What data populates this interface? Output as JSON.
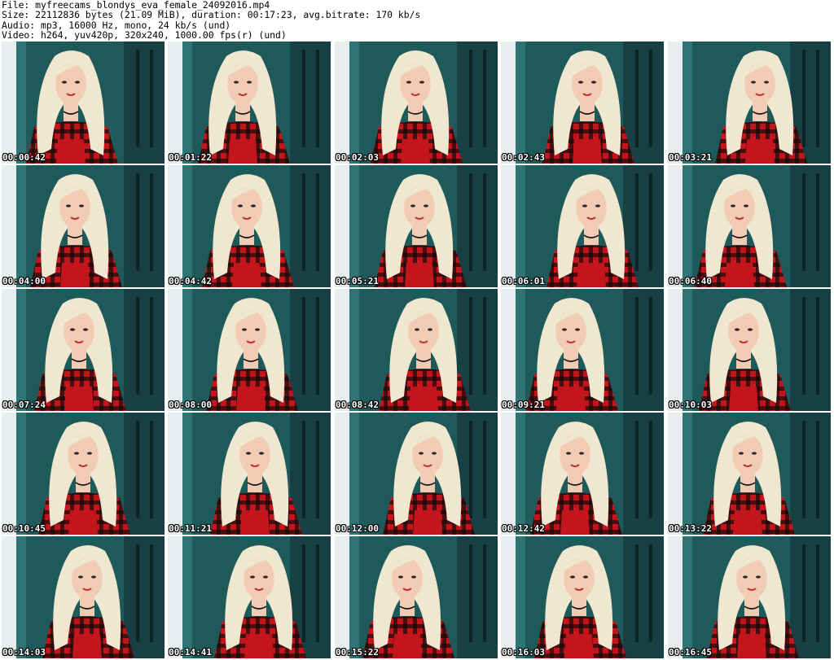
{
  "header": {
    "file": "File: myfreecams_blondys_eva_female_24092016.mp4",
    "size": "Size: 22112836 bytes (21.09 MiB), duration: 00:17:23, avg.bitrate: 170 kb/s",
    "audio": "Audio: mp3, 16000 Hz, mono, 24 kb/s (und)",
    "video": "Video: h264, yuv420p, 320x240, 1000.00 fps(r) (und)"
  },
  "thumbnails": [
    {
      "timestamp": "00:00:42"
    },
    {
      "timestamp": "00:01:22"
    },
    {
      "timestamp": "00:02:03"
    },
    {
      "timestamp": "00:02:43"
    },
    {
      "timestamp": "00:03:21"
    },
    {
      "timestamp": "00:04:00"
    },
    {
      "timestamp": "00:04:42"
    },
    {
      "timestamp": "00:05:21"
    },
    {
      "timestamp": "00:06:01"
    },
    {
      "timestamp": "00:06:40"
    },
    {
      "timestamp": "00:07:24"
    },
    {
      "timestamp": "00:08:00"
    },
    {
      "timestamp": "00:08:42"
    },
    {
      "timestamp": "00:09:21"
    },
    {
      "timestamp": "00:10:03"
    },
    {
      "timestamp": "00:10:45"
    },
    {
      "timestamp": "00:11:21"
    },
    {
      "timestamp": "00:12:00"
    },
    {
      "timestamp": "00:12:42"
    },
    {
      "timestamp": "00:13:22"
    },
    {
      "timestamp": "00:14:03"
    },
    {
      "timestamp": "00:14:41"
    },
    {
      "timestamp": "00:15:22"
    },
    {
      "timestamp": "00:16:03"
    },
    {
      "timestamp": "00:16:45"
    }
  ],
  "colors": {
    "background": "#ffffff",
    "text": "#000000",
    "timestamp_text": "#ffffff",
    "wall": "#1f5a5a",
    "hair": "#efe7cf",
    "shirt": "#c3161c",
    "skin": "#f2cbb4"
  }
}
